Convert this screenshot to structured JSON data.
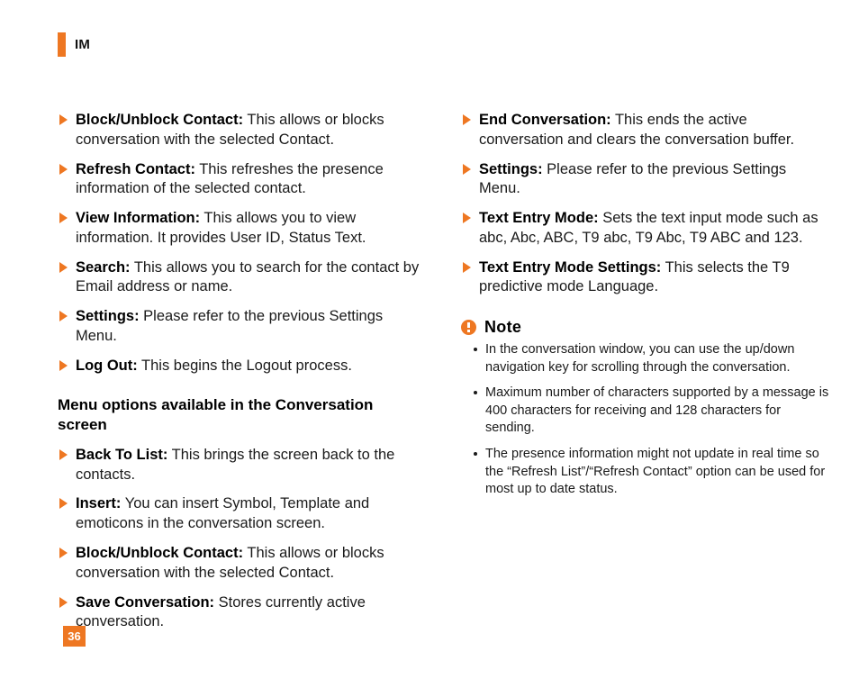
{
  "header": {
    "title": "IM",
    "rule_color": "#ee7722"
  },
  "colors": {
    "accent": "#ee7722",
    "text": "#1a1a1a",
    "heading": "#000000",
    "page_background": "#ffffff",
    "folio_text": "#ffffff"
  },
  "left_column": {
    "options": [
      {
        "term": "Block/Unblock Contact:",
        "desc": " This allows or blocks conversation with the selected Contact."
      },
      {
        "term": "Refresh Contact:",
        "desc": " This refreshes the presence information of the selected contact."
      },
      {
        "term": "View Information:",
        "desc": " This allows you to view information. It provides User ID, Status Text."
      },
      {
        "term": "Search:",
        "desc": " This allows you to search for the contact by Email address or name."
      },
      {
        "term": "Settings:",
        "desc": " Please refer to the previous Settings Menu."
      },
      {
        "term": "Log Out:",
        "desc": " This begins the Logout process."
      }
    ],
    "section_heading": "Menu options available in the Conversation screen",
    "options2": [
      {
        "term": "Back To List:",
        "desc": " This brings the screen back to the contacts."
      },
      {
        "term": "Insert:",
        "desc": " You can insert Symbol, Template and emoticons in the conversation screen."
      },
      {
        "term": "Block/Unblock Contact:",
        "desc": " This allows or blocks conversation with the selected Contact."
      },
      {
        "term": "Save Conversation:",
        "desc": " Stores currently active conversation."
      }
    ]
  },
  "right_column": {
    "options": [
      {
        "term": "End Conversation:",
        "desc": " This ends the active conversation and clears the conversation buffer."
      },
      {
        "term": "Settings:",
        "desc": " Please refer to the previous Settings Menu."
      },
      {
        "term": "Text Entry Mode:",
        "desc": " Sets the text input mode such as abc, Abc, ABC, T9 abc, T9 Abc, T9 ABC and 123."
      },
      {
        "term": "Text Entry Mode Settings:",
        "desc": " This selects the T9 predictive mode Language."
      }
    ],
    "note": {
      "icon": "exclamation-circle-icon",
      "title": "Note",
      "items": [
        "In the conversation window, you can use the up/down navigation key for scrolling through the conversation.",
        "Maximum number of characters supported by a message is 400 characters for receiving and 128 characters for sending.",
        "The presence information might not update in real time so the “Refresh List”/“Refresh Contact” option can be used for most up to date status."
      ]
    }
  },
  "folio": {
    "page_number": "36"
  }
}
